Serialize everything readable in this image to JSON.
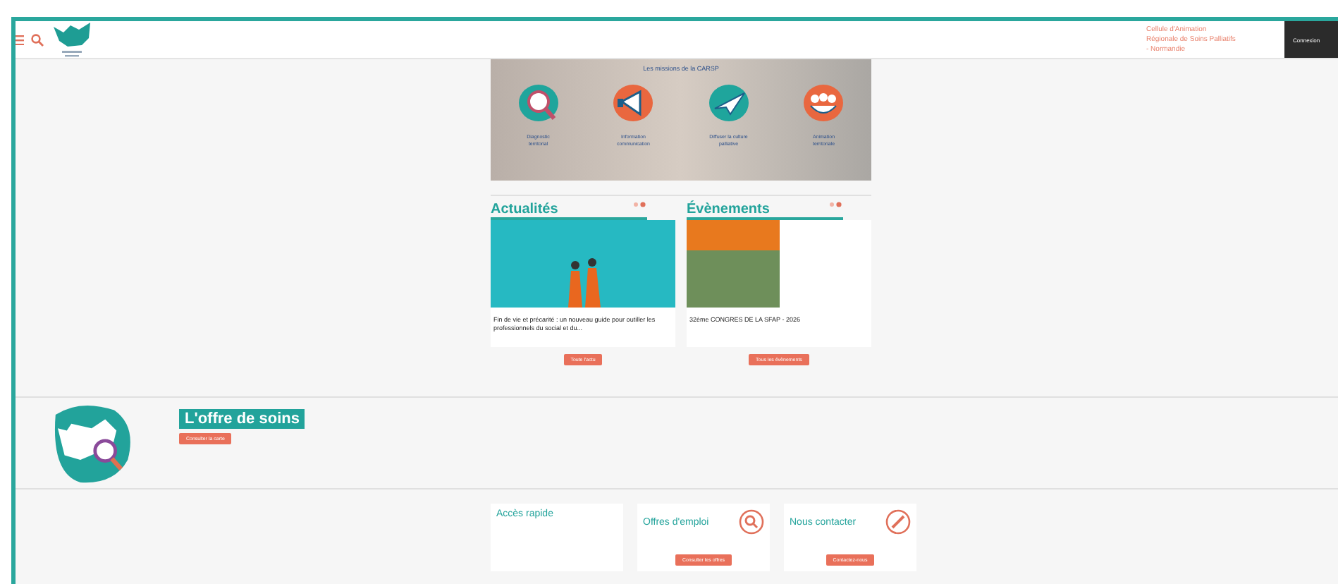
{
  "header": {
    "organisation": "Cellule d'Animation Régionale de Soins Palliatifs - Normandie",
    "login_button": "Connexion"
  },
  "missions": {
    "title": "Les missions de la CARSP",
    "items": [
      {
        "label": "Diagnostic territorial",
        "kind": "magnifier"
      },
      {
        "label": "Information communication",
        "kind": "megaphone"
      },
      {
        "label": "Diffuser la culture palliative",
        "kind": "plane"
      },
      {
        "label": "Animation territoriale",
        "kind": "people"
      }
    ]
  },
  "news": [
    {
      "title": "Actualités",
      "headline": "Fin de vie et précarité : un nouveau guide pour outiller les professionnels du social et du...",
      "button": "Toute l'actu",
      "kind": "guide"
    },
    {
      "title": "Évènements",
      "headline": "32ème CONGRES DE LA SFAP - 2026",
      "button": "Tous les évènements",
      "kind": "congress"
    }
  ],
  "offer": {
    "title": "L'offre de soins",
    "button": "Consulter la carte"
  },
  "footer_cards": [
    {
      "kind": "links",
      "title": "Accès rapide"
    },
    {
      "kind": "jobs",
      "title": "Offres d'emploi",
      "button": "Consulter les offres"
    },
    {
      "kind": "contact",
      "title": "Nous contacter",
      "button": "Contactez-nous"
    }
  ]
}
